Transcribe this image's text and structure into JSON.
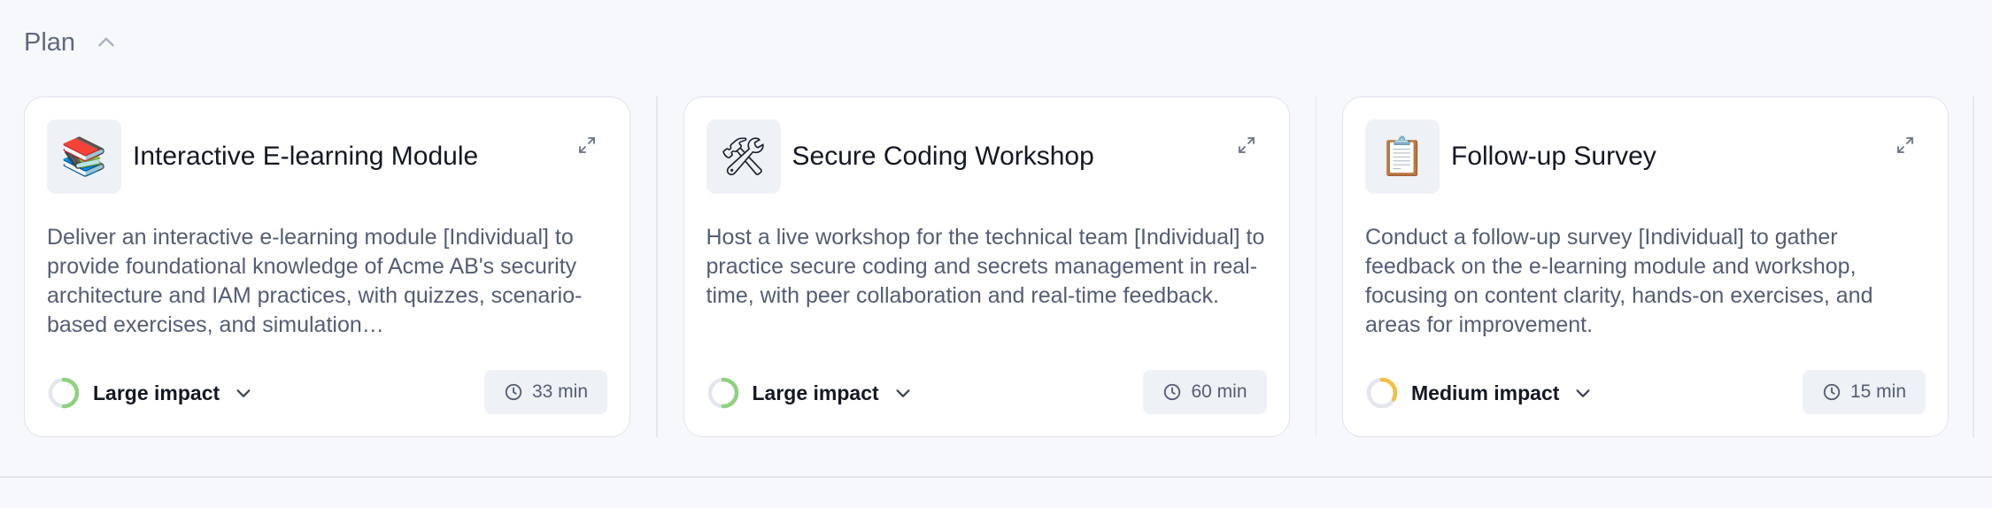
{
  "section": {
    "title": "Plan",
    "collapse_icon": "chevron-up-icon"
  },
  "cards": [
    {
      "icon": "📚",
      "icon_name": "books-icon",
      "title": "Interactive E-learning Module",
      "description": "Deliver an interactive e-learning module [Individual] to provide foundational knowledge of Acme AB's security architecture and IAM practices, with quizzes, scenario-based exercises, and simulation…",
      "impact": "Large impact",
      "impact_level": 0.5,
      "impact_color": "#8fd17f",
      "duration": "33 min"
    },
    {
      "icon": "🛠",
      "icon_name": "hammer-and-wrench-icon",
      "title": "Secure Coding Workshop",
      "description": "Host a live workshop for the technical team [Individual] to practice secure coding and secrets management in real-time, with peer collaboration and real-time feedback.",
      "impact": "Large impact",
      "impact_level": 0.5,
      "impact_color": "#8fd17f",
      "duration": "60 min"
    },
    {
      "icon": "📋",
      "icon_name": "clipboard-icon",
      "title": "Follow-up Survey",
      "description": "Conduct a follow-up survey [Individual] to gather feedback on the e-learning module and workshop, focusing on content clarity, hands-on exercises, and areas for improvement.",
      "impact": "Medium impact",
      "impact_level": 0.33,
      "impact_color": "#f5bf42",
      "duration": "15 min"
    }
  ]
}
